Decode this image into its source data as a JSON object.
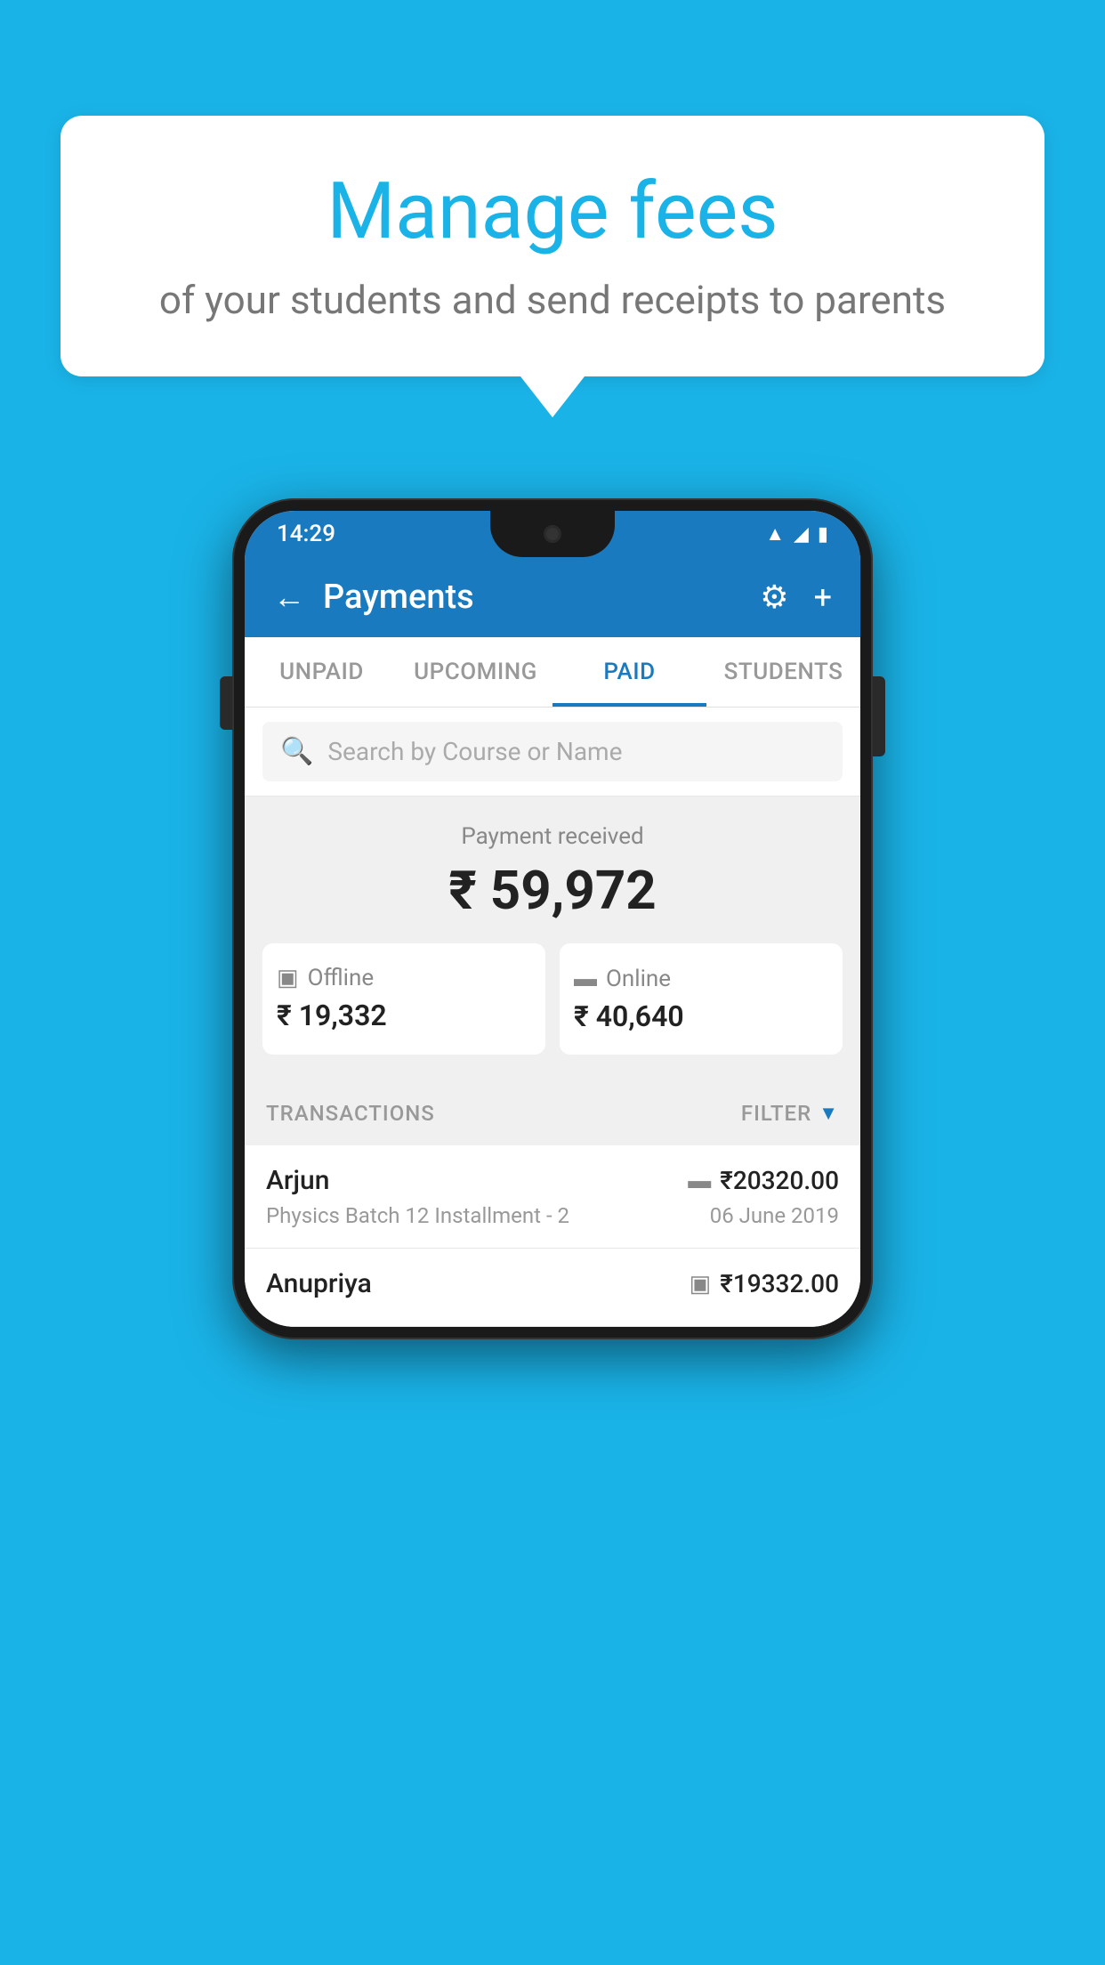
{
  "page": {
    "background_color": "#1ab3e8"
  },
  "speech_bubble": {
    "title": "Manage fees",
    "subtitle": "of your students and send receipts to parents"
  },
  "phone": {
    "status_bar": {
      "time": "14:29",
      "wifi_icon": "wifi",
      "signal_icon": "signal",
      "battery_icon": "battery"
    },
    "header": {
      "back_label": "←",
      "title": "Payments",
      "gear_icon": "⚙",
      "plus_icon": "+"
    },
    "tabs": [
      {
        "id": "unpaid",
        "label": "UNPAID",
        "active": false
      },
      {
        "id": "upcoming",
        "label": "UPCOMING",
        "active": false
      },
      {
        "id": "paid",
        "label": "PAID",
        "active": true
      },
      {
        "id": "students",
        "label": "STUDENTS",
        "active": false
      }
    ],
    "search": {
      "placeholder": "Search by Course or Name",
      "icon": "🔍"
    },
    "payment_summary": {
      "label": "Payment received",
      "amount": "₹ 59,972",
      "offline": {
        "label": "Offline",
        "amount": "₹ 19,332",
        "icon": "💳"
      },
      "online": {
        "label": "Online",
        "amount": "₹ 40,640",
        "icon": "💳"
      }
    },
    "transactions": {
      "section_label": "TRANSACTIONS",
      "filter_label": "FILTER",
      "items": [
        {
          "name": "Arjun",
          "detail": "Physics Batch 12 Installment - 2",
          "amount": "₹20320.00",
          "date": "06 June 2019",
          "payment_type": "online"
        },
        {
          "name": "Anupriya",
          "detail": "",
          "amount": "₹19332.00",
          "date": "",
          "payment_type": "offline"
        }
      ]
    }
  }
}
